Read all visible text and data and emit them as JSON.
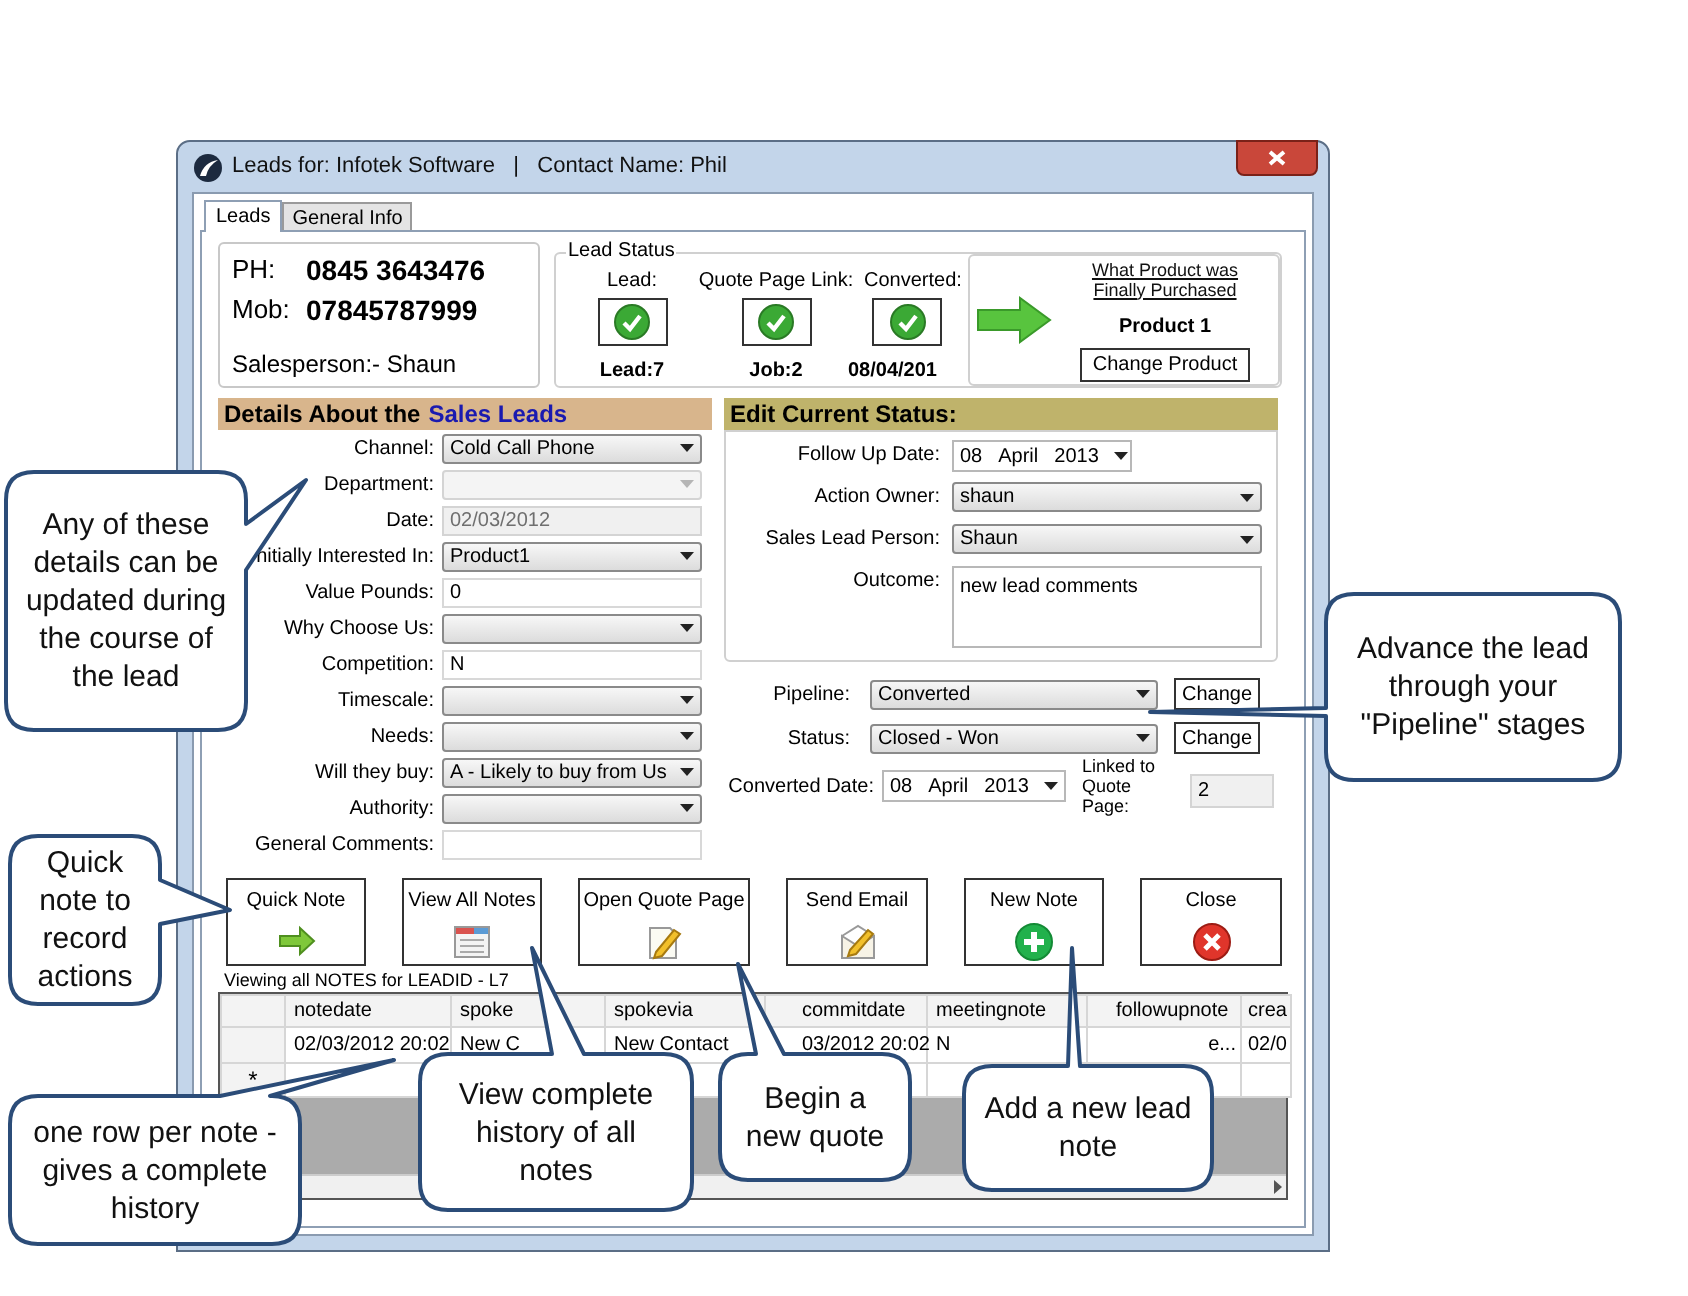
{
  "window": {
    "title": "Leads for: Infotek Software   |   Contact Name: Phil"
  },
  "tabs": [
    {
      "label": "Leads",
      "selected": true
    },
    {
      "label": "General Info",
      "selected": false
    }
  ],
  "contact": {
    "phone_label": "PH:",
    "phone": "0845 3643476",
    "mobile_label": "Mob:",
    "mobile": "07845787999",
    "salesperson": "Salesperson:- Shaun"
  },
  "lead_status": {
    "title": "Lead Status",
    "items": [
      {
        "label": "Lead:",
        "checked": true,
        "value": "Lead:7"
      },
      {
        "label": "Quote Page Link:",
        "checked": true,
        "value": "Job:2"
      },
      {
        "label": "Converted:",
        "checked": true,
        "value": "08/04/201"
      }
    ],
    "product": {
      "heading": "What Product was Finally Purchased",
      "name": "Product 1",
      "button": "Change Product"
    }
  },
  "details": {
    "title": "Details About the",
    "title_highlight": "Sales Leads",
    "fields": [
      {
        "label": "Channel:",
        "kind": "combo",
        "value": "Cold Call Phone",
        "disabled": false
      },
      {
        "label": "Department:",
        "kind": "combo",
        "disabled": true
      },
      {
        "label": "Date:",
        "kind": "text",
        "value": "02/03/2012",
        "disabled": true
      },
      {
        "label": "nitially Interested In:",
        "kind": "combo",
        "value": "Product1",
        "disabled": false
      },
      {
        "label": "Value Pounds:",
        "kind": "text",
        "value": "0",
        "disabled": false
      },
      {
        "label": "Why Choose Us:",
        "kind": "combo",
        "disabled": false
      },
      {
        "label": "Competition:",
        "kind": "text",
        "value": "N",
        "disabled": false
      },
      {
        "label": "Timescale:",
        "kind": "combo",
        "disabled": false
      },
      {
        "label": "Needs:",
        "kind": "combo",
        "disabled": false
      },
      {
        "label": "Will they buy:",
        "kind": "combo",
        "value": "A - Likely to buy from Us",
        "disabled": false
      },
      {
        "label": "Authority:",
        "kind": "combo",
        "disabled": false
      },
      {
        "label": "General Comments:",
        "kind": "text",
        "disabled": false
      }
    ]
  },
  "edit_status": {
    "title": "Edit Current Status:",
    "fields": [
      {
        "label": "Follow Up Date:",
        "kind": "date",
        "day": "08",
        "month": "April",
        "year": "2013"
      },
      {
        "label": "Action Owner:",
        "kind": "combo",
        "value": "shaun"
      },
      {
        "label": "Sales Lead Person:",
        "kind": "combo",
        "value": "Shaun"
      },
      {
        "label": "Outcome:",
        "kind": "textarea",
        "value": "new lead comments"
      }
    ]
  },
  "pipeline": {
    "label": "Pipeline:",
    "value": "Converted",
    "button": "Change"
  },
  "status": {
    "label": "Status:",
    "value": "Closed - Won",
    "button": "Change"
  },
  "converted_date": {
    "label": "Converted Date:",
    "day": "08",
    "month": "April",
    "year": "2013"
  },
  "linked_quote": {
    "label": "Linked to Quote Page:",
    "value": "2"
  },
  "actions": [
    {
      "label": "Quick Note",
      "kind": "arrow"
    },
    {
      "label": "View All Notes",
      "kind": "notes"
    },
    {
      "label": "Open Quote Page",
      "kind": "document"
    },
    {
      "label": "Send Email",
      "kind": "email"
    },
    {
      "label": "New Note",
      "kind": "add"
    },
    {
      "label": "Close",
      "kind": "close"
    }
  ],
  "notes_caption": "Viewing all NOTES for LEADID - L7",
  "notes_grid": {
    "columns": [
      "notedate",
      "spoke",
      "spokevia",
      "commitdate",
      "meetingnote",
      "followupnote",
      "crea"
    ],
    "rows": [
      [
        "02/03/2012 20:02",
        "New C",
        "New Contact",
        "03/2012 20:02",
        "N",
        "e...",
        "02/0"
      ]
    ],
    "new_row_marker": "*"
  },
  "callouts": [
    {
      "text": "Any of these details can be updated during the course of the lead"
    },
    {
      "text": "Quick note to record actions"
    },
    {
      "text": "one row per note - gives a complete history"
    },
    {
      "text": "View complete history of all notes"
    },
    {
      "text": "Begin a new quote"
    },
    {
      "text": "Add a new lead note"
    },
    {
      "text": "Advance the lead through your \"Pipeline\" stages"
    }
  ]
}
